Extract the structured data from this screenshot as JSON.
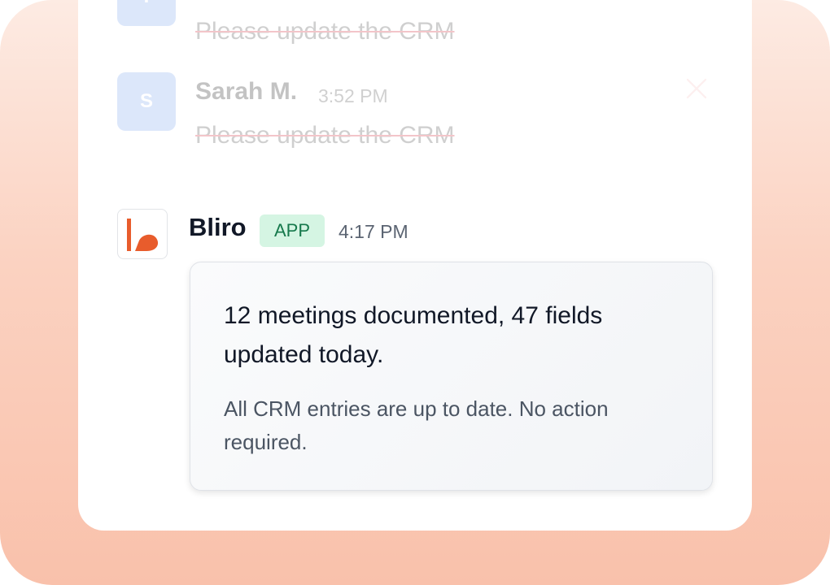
{
  "messages": [
    {
      "avatar_initial": "T",
      "text": "Please update the CRM"
    },
    {
      "avatar_initial": "S",
      "sender": "Sarah M.",
      "time": "3:52 PM",
      "text": "Please update the CRM"
    }
  ],
  "app_message": {
    "sender": "Bliro",
    "badge": "APP",
    "time": "4:17 PM",
    "summary_headline": "12 meetings documented, 47 fields updated today.",
    "summary_body": "All CRM entries are up to date. No action required."
  },
  "icons": {
    "dismiss": "close-icon",
    "app_logo": "bliro-logo-icon"
  },
  "colors": {
    "background_gradient_top": "#fdebe3",
    "background_gradient_bottom": "#f9c1ab",
    "avatar_blue": "#a9c4f5",
    "strike_red": "#e3707a",
    "badge_bg": "#d5f5e3",
    "badge_text": "#16794c",
    "logo_orange": "#e85c2c"
  }
}
